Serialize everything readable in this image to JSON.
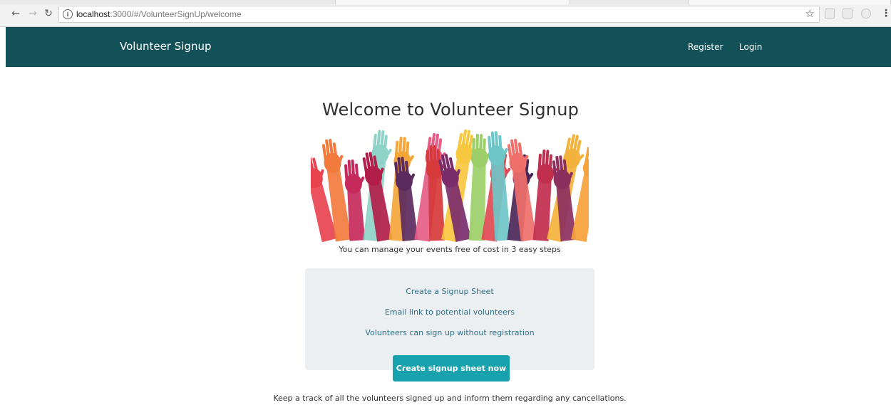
{
  "browser": {
    "url_host": "localhost",
    "url_rest": ":3000/#/VolunteerSignUp/welcome",
    "back_icon": "back-arrow-icon",
    "forward_icon": "forward-arrow-icon",
    "reload_icon": "reload-icon",
    "info_icon": "info-icon",
    "bookmark_icon": "star-icon",
    "menu_icon": "more-vertical-icon"
  },
  "header": {
    "brand": "Volunteer Signup",
    "nav": [
      "Register",
      "Login"
    ],
    "background_color": "#135158"
  },
  "main": {
    "title": "Welcome to Volunteer Signup",
    "hero_image": "raised-colorful-hands-illustration",
    "tagline": "You can manage your events free of cost in 3 easy steps",
    "steps": [
      "Create a Signup Sheet",
      "Email link to potential volunteers",
      "Volunteers can sign up without registration"
    ],
    "cta_label": "Create signup sheet now",
    "cta_color": "#18a2ae",
    "footer_text": "Keep a track of all the volunteers signed up and inform them regarding any cancellations."
  }
}
